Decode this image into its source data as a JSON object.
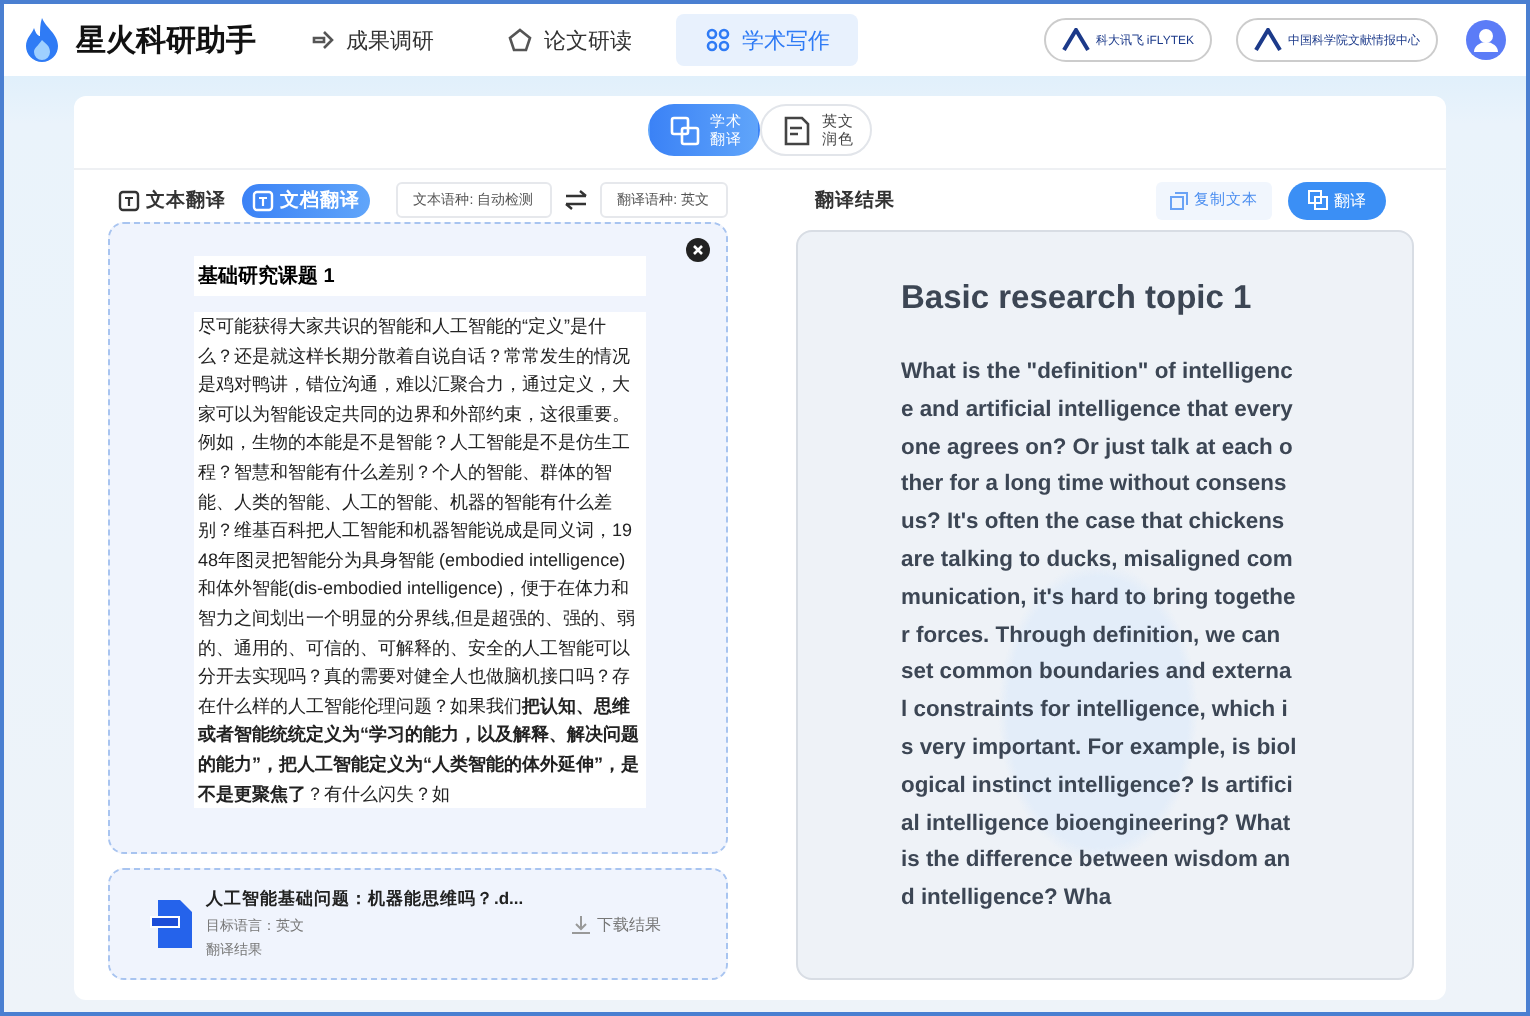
{
  "header": {
    "app_name": "星火科研助手",
    "nav": [
      {
        "label": "成果调研",
        "selected": false
      },
      {
        "label": "论文研读",
        "selected": false
      },
      {
        "label": "学术写作",
        "selected": true
      }
    ],
    "partners": [
      {
        "label": "科大讯飞 iFLYTEK"
      },
      {
        "label": "中国科学院文献情报中心"
      }
    ]
  },
  "modes": [
    {
      "label": "学术翻译",
      "selected": true
    },
    {
      "label": "英文润色",
      "selected": false
    }
  ],
  "source": {
    "tabs": [
      {
        "label": "文本翻译",
        "selected": false
      },
      {
        "label": "文档翻译",
        "selected": true
      }
    ],
    "source_language": "文本语种: 自动检测",
    "target_language": "翻译语种: 英文",
    "document": {
      "title": "基础研究课题 1",
      "body": "尽可能获得大家共识的智能和人工智能的“定义”是什么？还是就这样长期分散着自说自话？常常发生的情况是鸡对鸭讲，错位沟通，难以汇聚合力，通过定义，大家可以为智能设定共同的边界和外部约束，这很重要。例如，生物的本能是不是智能？人工智能是不是仿生工程？智慧和智能有什么差别？个人的智能、群体的智能、人类的智能、人工的智能、机器的智能有什么差别？维基百科把人工智能和机器智能说成是同义词，1948年图灵把智能分为具身智能 (embodied intelligence)和体外智能(dis-embodied intelligence)，便于在体力和智力之间划出一个明显的分界线,但是超强的、强的、弱的、通用的、可信的、可解释的、安全的人工智能可以分开去实现吗？真的需要对健全人也做脑机接口吗？存在什么样的人工智能伦理问题？如果我们**把认知、思维或者智能统统定义为“学习的能力，以及解释、解决问题的能力”，把人工智能定义为“人类智能的体外延伸”，是不是更聚焦了**？有什么闪失？如"
    },
    "file": {
      "name": "人工智能基础问题：机器能思维吗？.d...",
      "target": "目标语言：英文",
      "status": "翻译结果",
      "download": "下载结果"
    }
  },
  "result": {
    "heading": "翻译结果",
    "copy": "复制文本",
    "translate": "翻译",
    "title": "Basic research topic 1",
    "body": "What is the \"definition\" of intelligence and artificial intelligence that everyone agrees on? Or just talk at each other for a long time without consensus? It's often the case that chickens are talking to ducks, misaligned communication, it's hard to bring together forces. Through definition, we can set common boundaries and external constraints for intelligence, which is very important. For example, is biological instinct intelligence? Is artificial intelligence bioengineering? What is the difference between wisdom and intelligence? Wha"
  }
}
